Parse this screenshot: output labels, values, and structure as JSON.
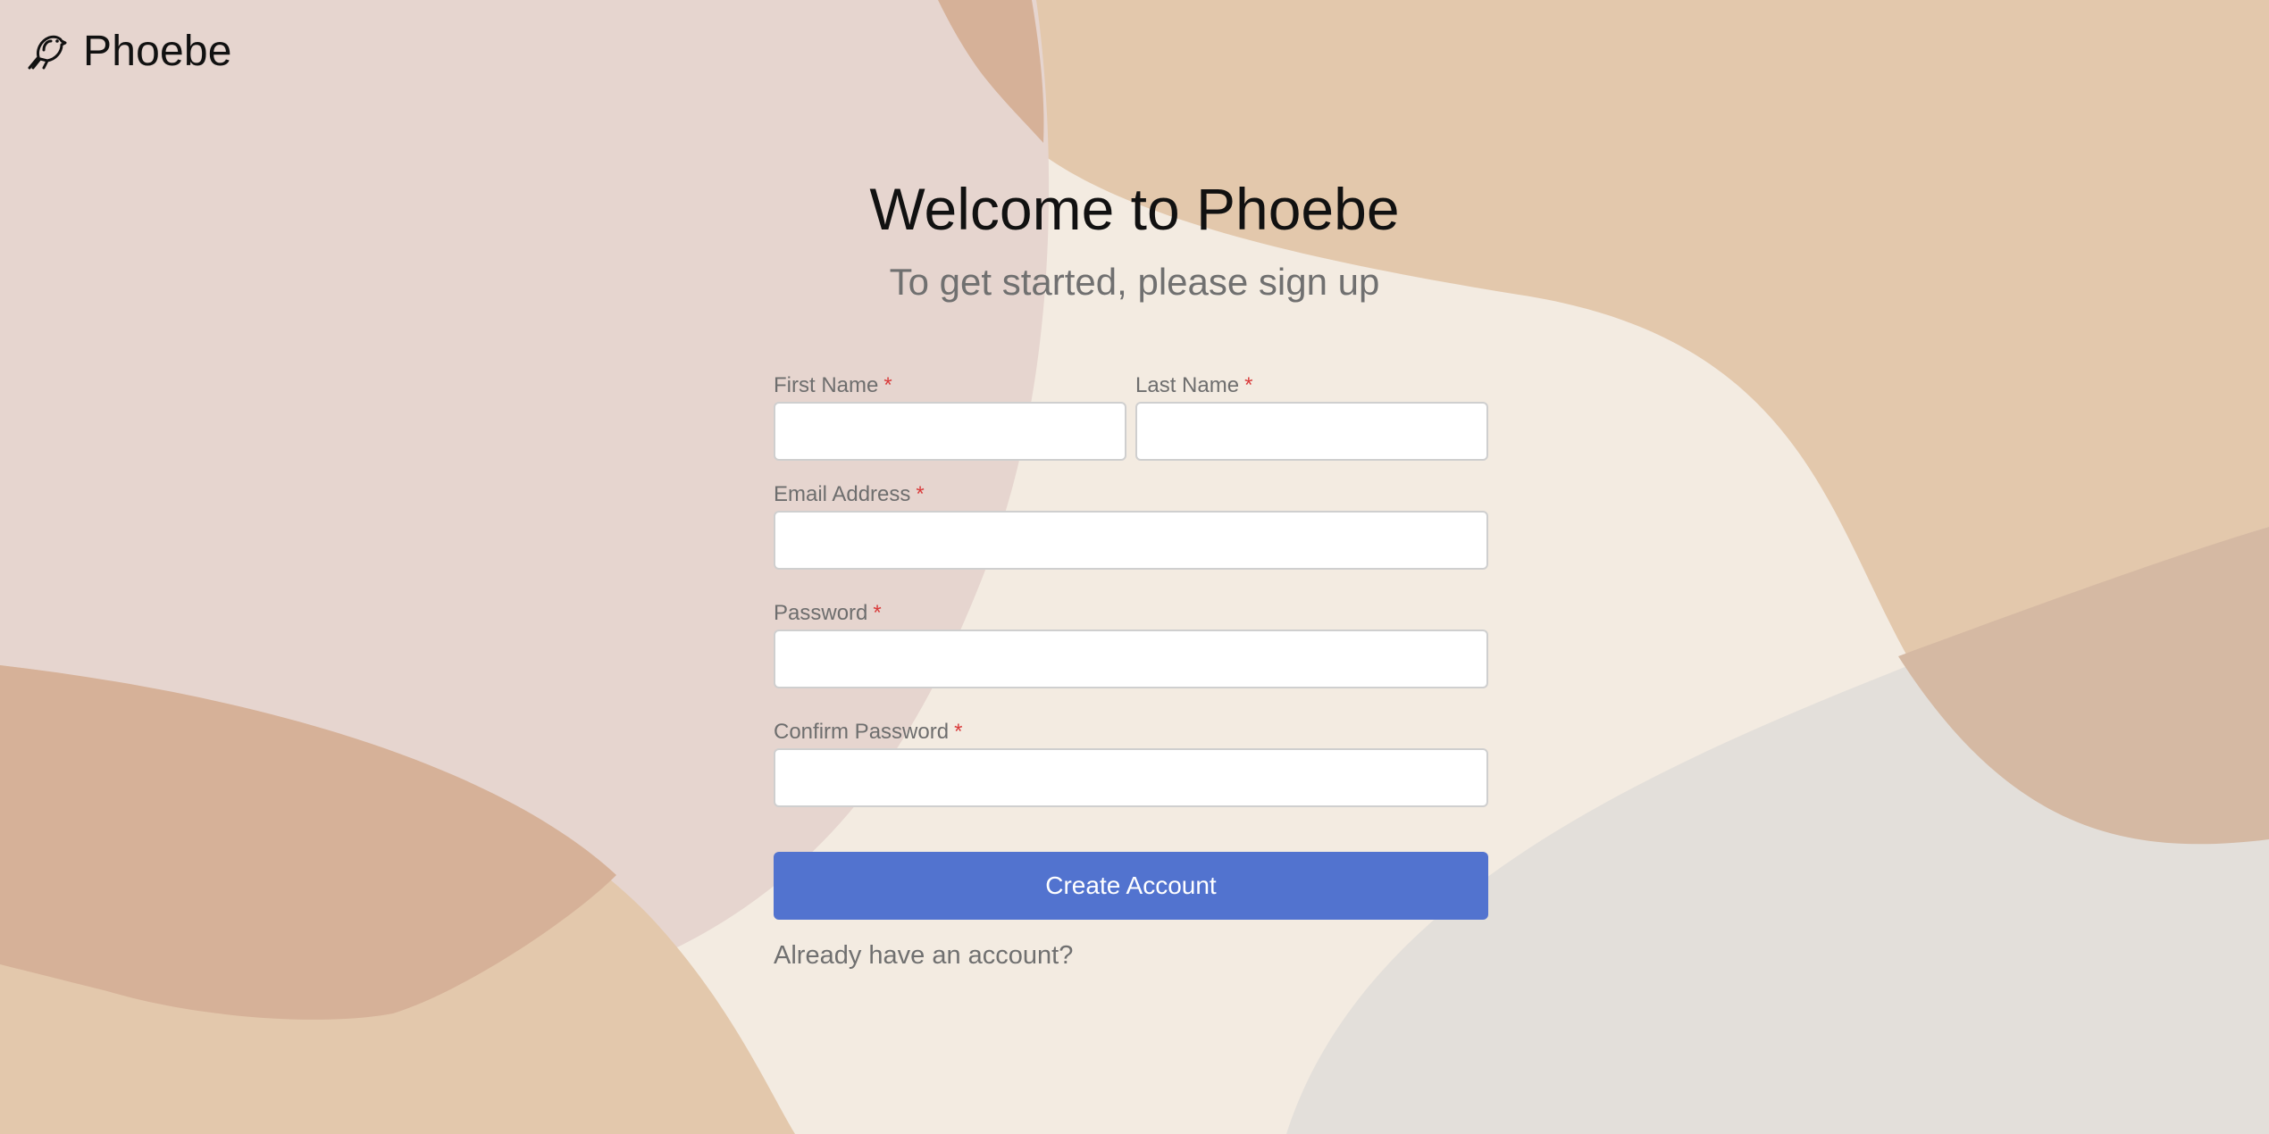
{
  "brand": {
    "name": "Phoebe",
    "icon": "bird-icon"
  },
  "hero": {
    "title": "Welcome to Phoebe",
    "subtitle": "To get started, please sign up"
  },
  "form": {
    "required_marker": "*",
    "first_name": {
      "label": "First Name",
      "value": ""
    },
    "last_name": {
      "label": "Last Name",
      "value": ""
    },
    "email": {
      "label": "Email Address",
      "value": ""
    },
    "password": {
      "label": "Password",
      "value": ""
    },
    "confirm_password": {
      "label": "Confirm Password",
      "value": ""
    },
    "submit_label": "Create Account",
    "signin_link": "Already have an account?"
  },
  "colors": {
    "accent": "#5273cf",
    "required": "#d93b3b",
    "bg_pink": "#e6d5cf",
    "bg_tan": "#e3c8ac",
    "bg_brown": "#d6b198",
    "bg_cream": "#f3ebe1",
    "bg_gray": "#e3dfda"
  }
}
